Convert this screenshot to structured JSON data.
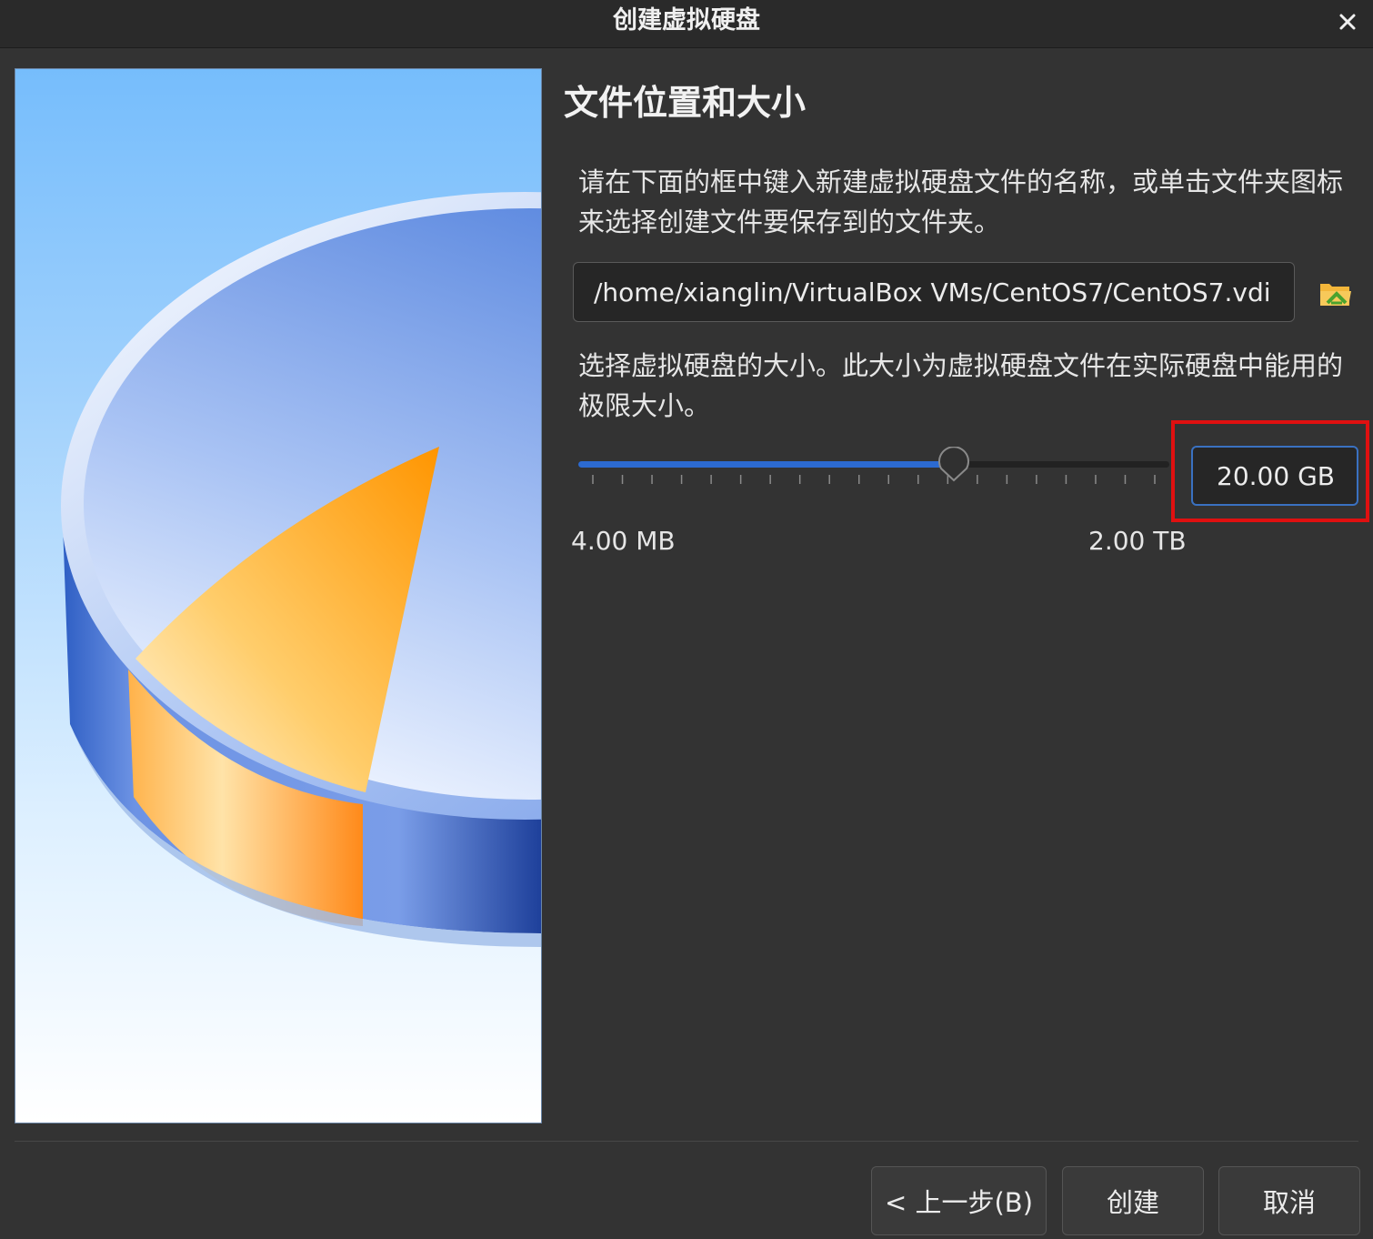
{
  "window": {
    "title": "创建虚拟硬盘",
    "close_icon": "close-icon"
  },
  "page": {
    "heading": "文件位置和大小",
    "location_description": "请在下面的框中键入新建虚拟硬盘文件的名称，或单击文件夹图标来选择创建文件要保存到的文件夹。",
    "file_path": "/home/xianglin/VirtualBox VMs/CentOS7/CentOS7.vdi",
    "folder_icon": "folder-open-icon",
    "size_description": "选择虚拟硬盘的大小。此大小为虚拟硬盘文件在实际硬盘中能用的极限大小。",
    "size_value": "20.00 GB",
    "size_min_label": "4.00 MB",
    "size_max_label": "2.00 TB",
    "slider_fraction": 0.635
  },
  "buttons": {
    "back": "< 上一步(B)",
    "create": "创建",
    "cancel": "取消"
  },
  "colors": {
    "background": "#333333",
    "accent": "#2c6ad0",
    "highlight": "#e01010"
  }
}
